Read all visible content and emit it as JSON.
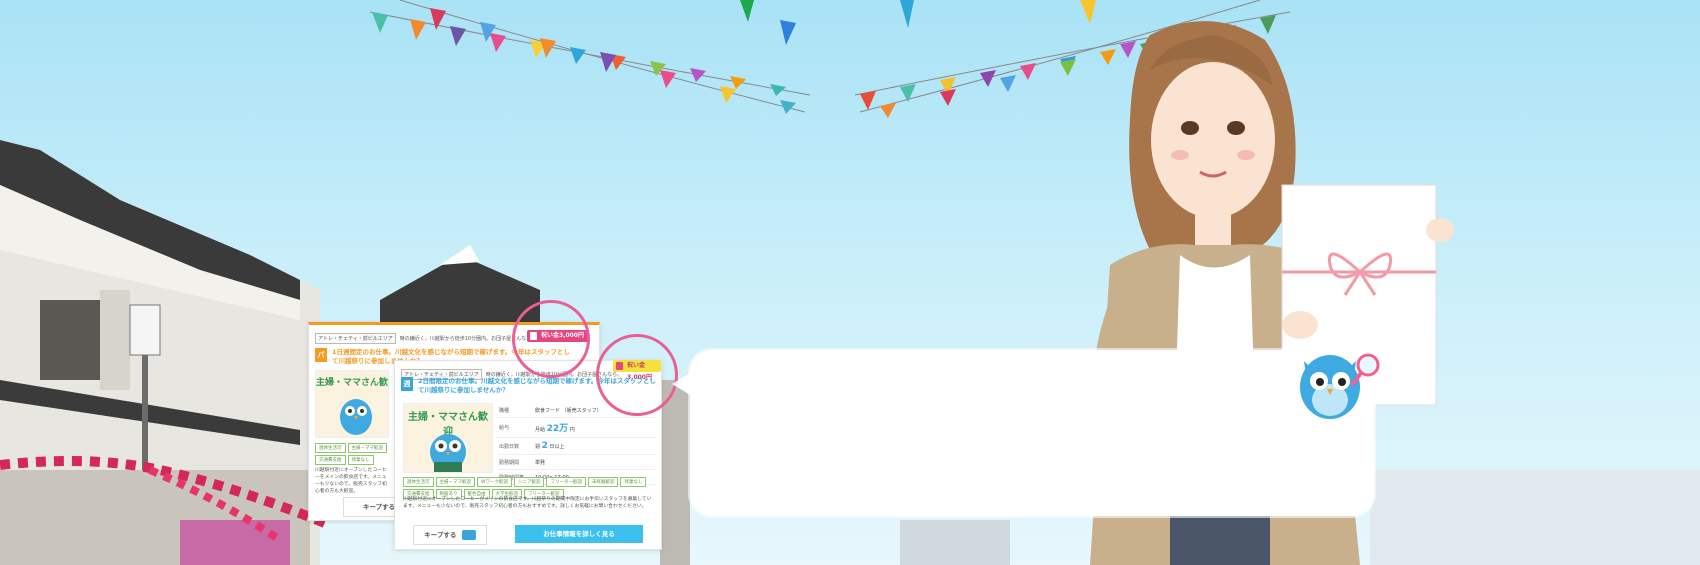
{
  "colors": {
    "accent_orange": "#f49b22",
    "accent_blue": "#3aa5dd",
    "highlight_pink": "#e95f93",
    "button_blue": "#3cc0ee"
  },
  "card_back": {
    "tag": "アトレ・チェティ・前ビルエリア",
    "subtitle": "時の鐘近く。川越駅から徒歩10分圏内。お団子屋さんなら。",
    "badge": "祝い金3,000円",
    "heading": "1日週間定のお仕事。川越文化を感じながら短期で稼げます。今年はスタッフとして川越祭りに参加しませんか？",
    "thumb_title": "主婦・ママさん歓",
    "chips": [
      "週休生活可",
      "主婦・ママ歓迎",
      "交通費支給",
      "残業なし"
    ],
    "description": "川越駅付近にオープンしたコーヒーをメインの飲食店です。メニューも少ないので、販売スタッフ初心者の方も大歓迎。",
    "keep_label": "キープする"
  },
  "card_front": {
    "tag": "アトレ・チェティ・前ビルエリア",
    "subtitle": "時の鐘近く。川越駅から徒歩10分圏内。お団子屋さんなら。",
    "badge": "祝い金3,000円",
    "icon_char": "週",
    "heading": "2日間限定のお仕事。川越文化を感じながら短期で稼げます。今年はスタッフとして川越祭りに参加しませんか？",
    "thumb_title": "主婦・ママさん歓迎",
    "info": [
      {
        "k": "職種",
        "v": "飲食フード",
        "extra": "（販売スタッフ）"
      },
      {
        "k": "給与",
        "v": "月給",
        "big": "22万",
        "unit": "円"
      },
      {
        "k": "出勤日数",
        "v": "週",
        "big": "2",
        "unit": "日以上"
      },
      {
        "k": "勤務期間",
        "v": "単発"
      },
      {
        "k": "勤務時間帯",
        "v": "10:00〜17:00"
      }
    ],
    "chips": [
      "週休生活可",
      "主婦・ママ歓迎",
      "Wワーク歓迎",
      "シニア歓迎",
      "フリーター歓迎",
      "未経験歓迎",
      "残業なし",
      "交通費支給",
      "制服あり",
      "髪色自由",
      "大学生歓迎",
      "フリーター歓迎"
    ],
    "description": "川越駅付近にオープンしたコーヒーがメインの飲食店です。川越祭りの期間中限定にお手伝いスタッフを募集しています。メニューも少ないので、販売スタッフ初心者の方もおすすめです。詳しくお気軽にお問い合わせください。",
    "keep_label": "キープする",
    "detail_label": "お仕事情報を詳しく見る"
  }
}
